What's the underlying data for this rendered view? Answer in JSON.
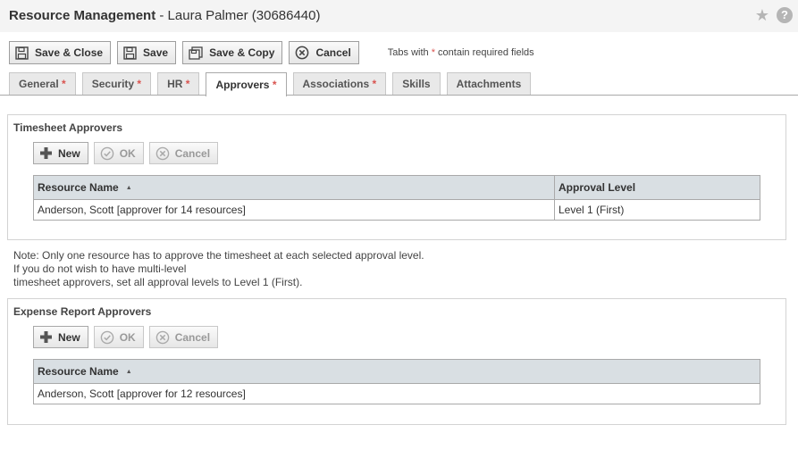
{
  "header": {
    "title_bold": "Resource Management",
    "title_rest": " - Laura Palmer (30686440)",
    "star_icon": "star-icon",
    "help_icon": "help-icon",
    "help_glyph": "?"
  },
  "toolbar": {
    "save_close_label": "Save & Close",
    "save_label": "Save",
    "save_copy_label": "Save & Copy",
    "cancel_label": "Cancel",
    "required_note_before": "Tabs with ",
    "required_note_star": "*",
    "required_note_after": " contain required fields"
  },
  "tabs": [
    {
      "label": "General",
      "required": "*",
      "active": false
    },
    {
      "label": "Security",
      "required": "*",
      "active": false
    },
    {
      "label": "HR",
      "required": "*",
      "active": false
    },
    {
      "label": "Approvers",
      "required": "*",
      "active": true
    },
    {
      "label": "Associations",
      "required": "*",
      "active": false
    },
    {
      "label": "Skills",
      "required": "",
      "active": false
    },
    {
      "label": "Attachments",
      "required": "",
      "active": false
    }
  ],
  "timesheet": {
    "title": "Timesheet Approvers",
    "new_label": "New",
    "ok_label": "OK",
    "cancel_label": "Cancel",
    "columns": [
      "Resource Name",
      "Approval Level"
    ],
    "rows": [
      {
        "name": "Anderson, Scott [approver for 14 resources]",
        "level": "Level 1 (First)"
      }
    ]
  },
  "note": {
    "line1": "Note: Only one resource has to approve the timesheet at each selected approval level.",
    "line2": "If you do not wish to have multi-level",
    "line3": "timesheet approvers, set all approval levels to Level 1 (First)."
  },
  "expense": {
    "title": "Expense Report Approvers",
    "new_label": "New",
    "ok_label": "OK",
    "cancel_label": "Cancel",
    "columns": [
      "Resource Name"
    ],
    "rows": [
      {
        "name": "Anderson, Scott [approver for 12 resources]"
      }
    ]
  },
  "colors": {
    "grid_header": "#d9dfe3",
    "required_star": "#d9534f",
    "plus_icon": "#555555"
  }
}
